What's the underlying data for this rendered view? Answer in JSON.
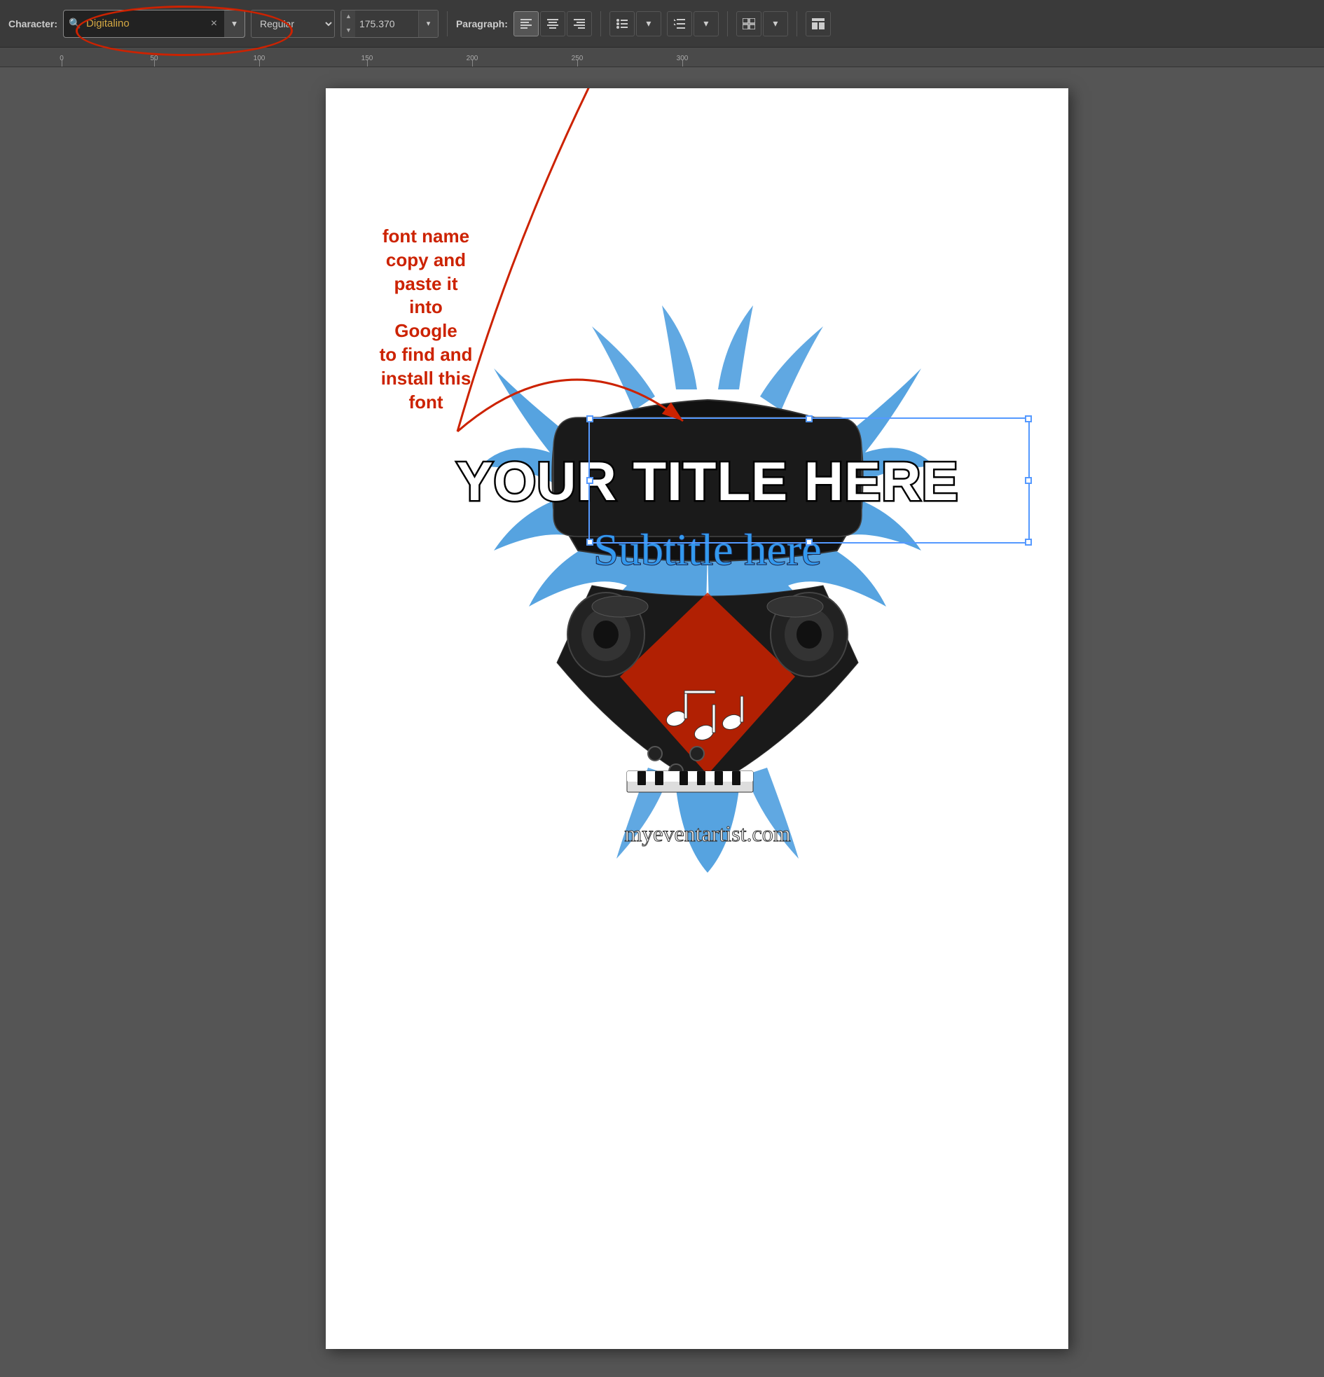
{
  "toolbar": {
    "character_label": "Character:",
    "font_name": "Digitalino",
    "font_style": "Regular",
    "font_size": "175.370",
    "paragraph_label": "Paragraph:",
    "clear_btn": "×",
    "dropdown_arrow": "▾",
    "size_up": "▲",
    "size_down": "▼",
    "align_left": "≡",
    "align_center": "≡",
    "align_right": "≡",
    "bullet_icon": "≡",
    "line_spacing_icon": "≡",
    "panel_icon": "⊞"
  },
  "ruler": {
    "marks": [
      0,
      50,
      100,
      150,
      200,
      250,
      300
    ]
  },
  "annotation": {
    "line1": "font name",
    "line2": "copy and",
    "line3": "paste it",
    "line4": "into",
    "line5": "Google",
    "line6": "to find and",
    "line7": "install this",
    "line8": "font"
  },
  "design": {
    "title": "YOUR TITLE HERE",
    "subtitle": "Subtitle here",
    "url": "myeventartist.com"
  },
  "colors": {
    "toolbar_bg": "#3a3a3a",
    "canvas_bg": "#555555",
    "page_bg": "#ffffff",
    "annotation_color": "#cc2200",
    "selection_color": "#5599ff",
    "design_blue": "#4499dd",
    "font_color": "#d4a843"
  }
}
